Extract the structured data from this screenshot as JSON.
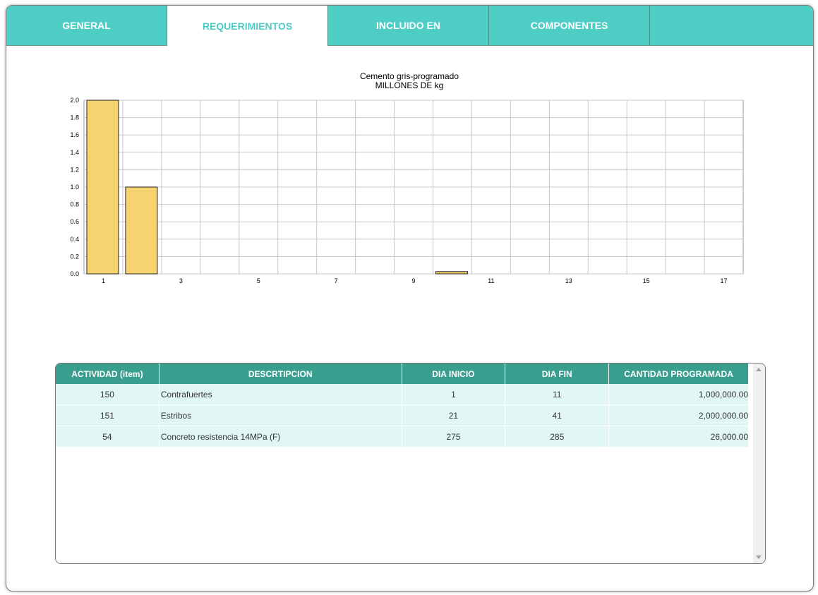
{
  "tabs": [
    {
      "label": "GENERAL"
    },
    {
      "label": "REQUERIMIENTOS"
    },
    {
      "label": "INCLUIDO EN"
    },
    {
      "label": "COMPONENTES"
    }
  ],
  "chart": {
    "title_line1": "Cemento gris-programado",
    "title_line2": "MILLONES DE kg"
  },
  "chart_data": {
    "type": "bar",
    "title": "Cemento gris-programado MILLONES DE kg",
    "categories": [
      1,
      2,
      3,
      4,
      5,
      6,
      7,
      8,
      9,
      10,
      11,
      12,
      13,
      14,
      15,
      16,
      17
    ],
    "values": [
      2.0,
      1.0,
      0,
      0,
      0,
      0,
      0,
      0,
      0,
      0.026,
      0,
      0,
      0,
      0,
      0,
      0,
      0
    ],
    "x_tick_labels": [
      "1",
      "3",
      "5",
      "7",
      "9",
      "11",
      "13",
      "15",
      "17"
    ],
    "y_tick_labels": [
      "0.0",
      "0.2",
      "0.4",
      "0.6",
      "0.8",
      "1.0",
      "1.2",
      "1.4",
      "1.6",
      "1.8",
      "2.0"
    ],
    "ylim": [
      0,
      2.0
    ],
    "grid": true,
    "bar_color": "#f7d36f"
  },
  "table": {
    "headers": [
      "ACTIVIDAD (item)",
      "DESCRTIPCION",
      "DIA INICIO",
      "DIA FIN",
      "CANTIDAD PROGRAMADA"
    ],
    "rows": [
      [
        "150",
        "Contrafuertes",
        "1",
        "11",
        "1,000,000.00"
      ],
      [
        "151",
        "Estribos",
        "21",
        "41",
        "2,000,000.00"
      ],
      [
        "54",
        "Concreto resistencia 14MPa (F)",
        "275",
        "285",
        "26,000.00"
      ]
    ]
  },
  "colors": {
    "tab_bar": "#4ecdc4",
    "table_header": "#3a9e8f",
    "row_bg": "#e0f7f5"
  }
}
